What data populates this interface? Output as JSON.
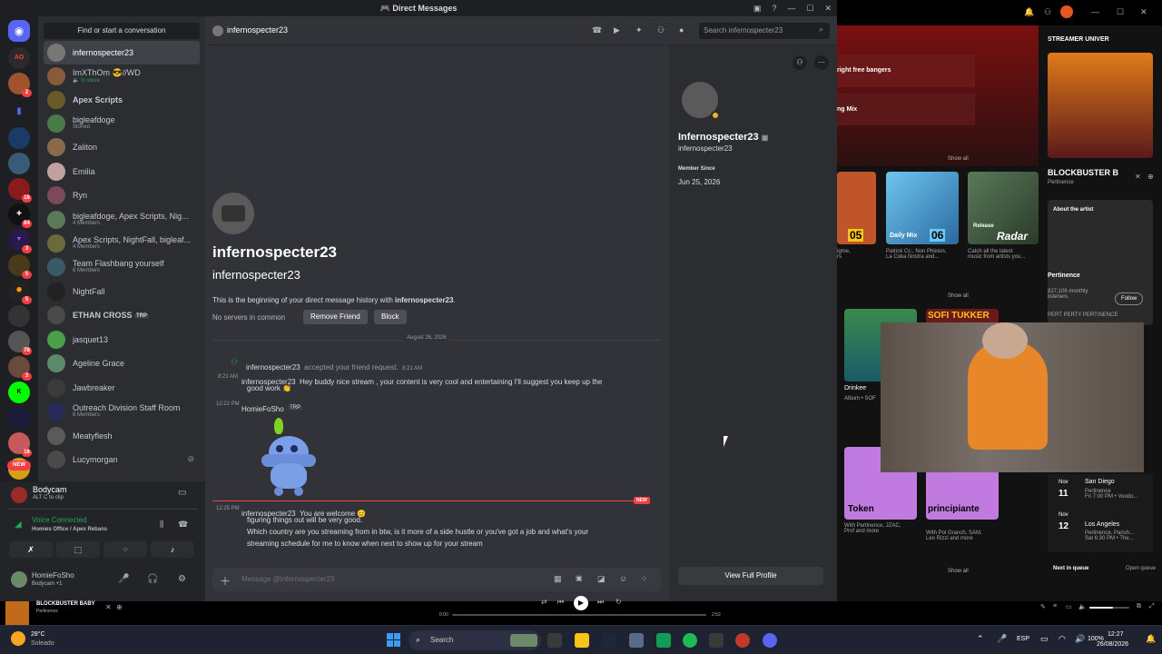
{
  "window": {
    "title": "Direct Messages"
  },
  "dm_list": {
    "find_placeholder": "Find or start a conversation",
    "items": [
      {
        "name": "infernospecter23",
        "sub": ""
      },
      {
        "name": "ImXThOm 😎//WD",
        "sub": "🔈 In voice"
      },
      {
        "name": "Apex Scripts",
        "sub": ""
      },
      {
        "name": "bigleafdoge",
        "sub": "Stoned"
      },
      {
        "name": "Zaliton",
        "sub": ""
      },
      {
        "name": "Emilia",
        "sub": ""
      },
      {
        "name": "Ryn",
        "sub": ""
      },
      {
        "name": "bigleafdoge, Apex Scripts, Nig...",
        "sub": "4 Members"
      },
      {
        "name": "Apex Scripts, NightFall, bigleaf...",
        "sub": "4 Members"
      },
      {
        "name": "Team Flashbang yourself",
        "sub": "6 Members"
      },
      {
        "name": "NightFall",
        "sub": ""
      },
      {
        "name": "ETHAN CROSS",
        "sub": "",
        "tag": "TRP"
      },
      {
        "name": "jasquet13",
        "sub": ""
      },
      {
        "name": "Ageline Grace",
        "sub": ""
      },
      {
        "name": "Jawbreaker",
        "sub": ""
      },
      {
        "name": "Outreach Division Staff Room",
        "sub": "8 Members"
      },
      {
        "name": "Meatyflesh",
        "sub": ""
      },
      {
        "name": "Lucymorgan",
        "sub": ""
      }
    ],
    "new_badge": "NEW"
  },
  "servers": {
    "badges": [
      "2",
      "16",
      "64",
      "3",
      "5",
      "5",
      "78",
      "3",
      "16"
    ]
  },
  "user_panel": {
    "activity_name": "Bodycam",
    "activity_sub": "ALT  C  to clip",
    "voice_status": "Voice Connected",
    "voice_channel": "Homies Office / Apex Rebans",
    "username": "HomieFoSho",
    "user_status": "Bodycam +1"
  },
  "chat_header": {
    "recipient": "infernospecter23",
    "search_placeholder": "Search infernospecter23"
  },
  "chat": {
    "intro_display_name": "infernospecter23",
    "intro_username": "infernospecter23",
    "intro_text_prefix": "This is the beginning of your direct message history with ",
    "intro_text_user": "infernospecter23",
    "intro_text_suffix": ".",
    "no_servers": "No servers in common",
    "remove_friend_label": "Remove Friend",
    "block_label": "Block",
    "date_divider": "August 26, 2026",
    "system_user": "infernospecter23",
    "system_text": "accepted your friend request.",
    "system_time": "8:21 AM",
    "msg1_time": "8:21 AM",
    "msg1_user": "infernospecter23",
    "msg1_text_line1": "Hey buddy nice stream , your content is very cool and entertaining I'll suggest you keep up the",
    "msg1_text_line2": "good work 👏",
    "msg2_time": "12:22 PM",
    "msg2_user": "HomieFoSho",
    "msg2_tag": "TRP",
    "new_label": "NEW",
    "msg3_time": "12:25 PM",
    "msg3_user": "infernospecter23",
    "msg3_text_line1": "You are welcome 😊",
    "msg3_text_line2": "figuring things out will be very good.",
    "msg3_text_line3": "Which country are you streaming from in btw, is it more of a side hustle or you've got a job and what's your",
    "msg3_text_line4": "streaming schedule for me to know when next to show up for your stream",
    "composer_placeholder": "Message @infernospecter23"
  },
  "profile": {
    "display_name": "Infernospecter23",
    "username": "infernospecter23",
    "member_since_label": "Member Since",
    "member_since_value": "Jun 25, 2026",
    "view_full_label": "View Full Profile"
  },
  "spotify": {
    "header_label": "STREAMER UNIVER",
    "row1": "right free bangers",
    "row2": "ng Mix",
    "show_all_1": "Show all",
    "show_all_2": "Show all",
    "show_all_3": "Show all",
    "cards": [
      {
        "badge": "05",
        "caption": "igme,\nrs"
      },
      {
        "badge": "06",
        "top": "Daily Mix",
        "caption": "Patrick Cc:, Non Phixion,\nLa Coka Nostra and..."
      },
      {
        "badge": "Radar",
        "top": "Release",
        "caption": "Catch all the latest\nmusic from artists you..."
      }
    ],
    "album_title": "Drinkee",
    "album_sub": "Album • SOF",
    "sofi_label": "SOFI TUKKER",
    "token_label": "Token",
    "token_caption": "With Pertinence, JZAC,\nProf and more",
    "principiante_label": "principiante",
    "principiante_caption": "With Pol Granch, SAM,\nLeo Rizzi and more",
    "now_playing_title": "BLOCKBUSTER B",
    "now_playing_artist": "Pertinence",
    "about_artist": "About the artist",
    "artist_name": "Pertinence",
    "listeners": "827,106 monthly\nlisteners",
    "follow_label": "Follow",
    "artist_desc": "PERT PERTY PERTINENCE",
    "events": [
      {
        "month": "Nov",
        "day": "11",
        "city": "San Diego",
        "detail": "Pertinence\nFri 7:00 PM • Voodo..."
      },
      {
        "month": "Nov",
        "day": "12",
        "city": "Los Angeles",
        "detail": "Pertinence, Parish...\nSat 6:30 PM • The..."
      }
    ],
    "next_in_queue": "Next in queue",
    "open_queue": "Open queue"
  },
  "player": {
    "track": "BLOCKBUSTER BABY",
    "artist": "Pertinence",
    "elapsed": "0:00",
    "duration": "2:52",
    "volume_level": 0.6
  },
  "taskbar": {
    "weather_temp": "28°C",
    "weather_desc": "Soleado",
    "search_label": "Search",
    "lang": "ESP",
    "battery": "100%",
    "time": "12:27",
    "date": "26/08/2026"
  },
  "colors": {
    "discord_bg": "#313338",
    "blurple": "#5865f2",
    "red": "#f23f43",
    "spotify_bg": "#121212",
    "green": "#23a55a"
  }
}
